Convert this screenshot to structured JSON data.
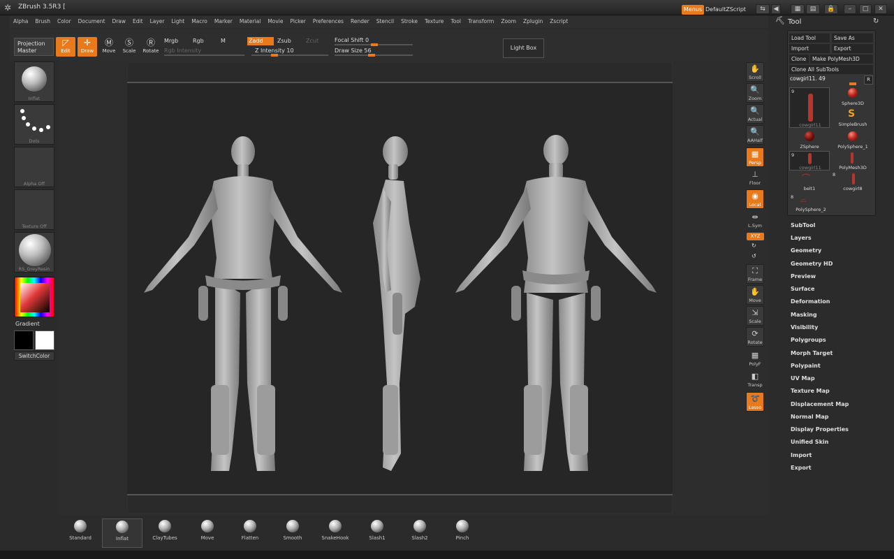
{
  "app": {
    "title": "ZBrush 3.5R3 ["
  },
  "titlebar": {
    "menus_label": "Menus",
    "script_label": "DefaultZScript"
  },
  "menubar": [
    "Alpha",
    "Brush",
    "Color",
    "Document",
    "Draw",
    "Edit",
    "Layer",
    "Light",
    "Macro",
    "Marker",
    "Material",
    "Movie",
    "Picker",
    "Preferences",
    "Render",
    "Stencil",
    "Stroke",
    "Texture",
    "Tool",
    "Transform",
    "Zoom",
    "Zplugin",
    "Zscript"
  ],
  "shelf": {
    "projection_master": "Projection Master",
    "edit": "Edit",
    "draw": "Draw",
    "move": "Move",
    "scale": "Scale",
    "rotate": "Rotate",
    "mrgb": "Mrgb",
    "rgb": "Rgb",
    "m": "M",
    "zadd": "Zadd",
    "zsub": "Zsub",
    "zcut": "Zcut",
    "rgb_intensity": "Rgb Intensity",
    "z_intensity": "Z Intensity 10",
    "focal_shift": "Focal Shift 0",
    "draw_size": "Draw Size 56",
    "light_box": "Light Box"
  },
  "left_tray": {
    "brush_caption": "Inflat",
    "stroke_caption": "Dots",
    "alpha_caption": "Alpha Off",
    "texture_caption": "Texture Off",
    "material_caption": "RS_GreyResin",
    "gradient_label": "Gradient",
    "switch_color": "SwitchColor"
  },
  "view_controls": {
    "scroll": "Scroll",
    "zoom": "Zoom",
    "actual": "Actual",
    "aahalf": "AAHalf",
    "persp": "Persp",
    "floor": "Floor",
    "local": "Local",
    "lsym": "L.Sym",
    "xyz": "XYZ",
    "frame": "Frame",
    "move": "Move",
    "scale": "Scale",
    "rotate": "Rotate",
    "polyf": "PolyF",
    "transp": "Transp",
    "lasso": "Lasso"
  },
  "tool_panel": {
    "header": "Tool",
    "load_tool": "Load Tool",
    "save_as": "Save As",
    "import": "Import",
    "export": "Export",
    "clone": "Clone",
    "make_polymesh": "Make PolyMesh3D",
    "clone_all_subtools": "Clone All SubTools",
    "current_tool": "cowgirl11. 49",
    "r_label": "R",
    "tools": [
      {
        "name": "cowgirl11",
        "count": "9"
      },
      {
        "name": "Sphere3D"
      },
      {
        "name": "SimpleBrush"
      },
      {
        "name": "ZSphere"
      },
      {
        "name": "PolySphere_1"
      },
      {
        "name": "cowgirl11",
        "count": "9"
      },
      {
        "name": "PolyMesh3D"
      },
      {
        "name": "belt1"
      },
      {
        "name": "cowgirl8",
        "count": "8"
      },
      {
        "name": "PolySphere_2",
        "count": "8"
      }
    ],
    "sections": [
      "SubTool",
      "Layers",
      "Geometry",
      "Geometry HD",
      "Preview",
      "Surface",
      "Deformation",
      "Masking",
      "Visibility",
      "Polygroups",
      "Morph Target",
      "Polypaint",
      "UV Map",
      "Texture Map",
      "Displacement Map",
      "Normal Map",
      "Display Properties",
      "Unified Skin",
      "Import",
      "Export"
    ]
  },
  "bottom_brushes": [
    "Standard",
    "Inflat",
    "ClayTubes",
    "Move",
    "Flatten",
    "Smooth",
    "SnakeHook",
    "Slash1",
    "Slash2",
    "Pinch"
  ],
  "colors": {
    "accent": "#e87a1c",
    "model": "#b5b5b5",
    "canvas": "#262626"
  }
}
